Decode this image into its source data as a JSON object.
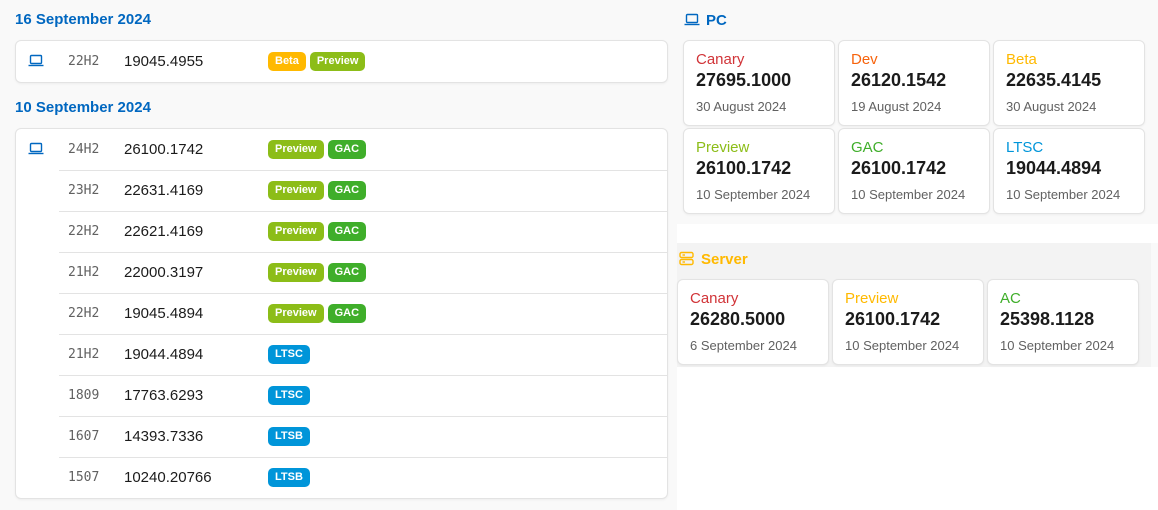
{
  "colors": {
    "heading": "#0067c0",
    "canary": "#d13438",
    "dev": "#f7630c",
    "beta": "#ffb900",
    "preview": "#8cbd18",
    "gac": "#3fae2a",
    "ltsc": "#0095d9",
    "server": "#ffb900"
  },
  "releases": [
    {
      "date": "16 September 2024",
      "icon": "laptop-icon",
      "rows": [
        {
          "version": "22H2",
          "build": "19045.4955",
          "badges": [
            "Beta",
            "Preview"
          ]
        }
      ]
    },
    {
      "date": "10 September 2024",
      "icon": "laptop-icon",
      "rows": [
        {
          "version": "24H2",
          "build": "26100.1742",
          "badges": [
            "Preview",
            "GAC"
          ]
        },
        {
          "version": "23H2",
          "build": "22631.4169",
          "badges": [
            "Preview",
            "GAC"
          ]
        },
        {
          "version": "22H2",
          "build": "22621.4169",
          "badges": [
            "Preview",
            "GAC"
          ]
        },
        {
          "version": "21H2",
          "build": "22000.3197",
          "badges": [
            "Preview",
            "GAC"
          ]
        },
        {
          "version": "22H2",
          "build": "19045.4894",
          "badges": [
            "Preview",
            "GAC"
          ]
        },
        {
          "version": "21H2",
          "build": "19044.4894",
          "badges": [
            "LTSC"
          ]
        },
        {
          "version": "1809",
          "build": "17763.6293",
          "badges": [
            "LTSC"
          ]
        },
        {
          "version": "1607",
          "build": "14393.7336",
          "badges": [
            "LTSB"
          ]
        },
        {
          "version": "1507",
          "build": "10240.20766",
          "badges": [
            "LTSB"
          ]
        }
      ]
    }
  ],
  "pc": {
    "title": "PC",
    "icon": "laptop-icon",
    "tiles": [
      {
        "channel": "Canary",
        "build": "27695.1000",
        "date": "30 August 2024",
        "color": "#d13438"
      },
      {
        "channel": "Dev",
        "build": "26120.1542",
        "date": "19 August 2024",
        "color": "#f7630c"
      },
      {
        "channel": "Beta",
        "build": "22635.4145",
        "date": "30 August 2024",
        "color": "#ffb900"
      },
      {
        "channel": "Preview",
        "build": "26100.1742",
        "date": "10 September 2024",
        "color": "#8cbd18"
      },
      {
        "channel": "GAC",
        "build": "26100.1742",
        "date": "10 September 2024",
        "color": "#3fae2a"
      },
      {
        "channel": "LTSC",
        "build": "19044.4894",
        "date": "10 September 2024",
        "color": "#0095d9"
      }
    ]
  },
  "server": {
    "title": "Server",
    "icon": "server-icon",
    "tiles": [
      {
        "channel": "Canary",
        "build": "26280.5000",
        "date": "6 September 2024",
        "color": "#d13438"
      },
      {
        "channel": "Preview",
        "build": "26100.1742",
        "date": "10 September 2024",
        "color": "#ffb900"
      },
      {
        "channel": "AC",
        "build": "25398.1128",
        "date": "10 September 2024",
        "color": "#3fae2a"
      }
    ]
  }
}
